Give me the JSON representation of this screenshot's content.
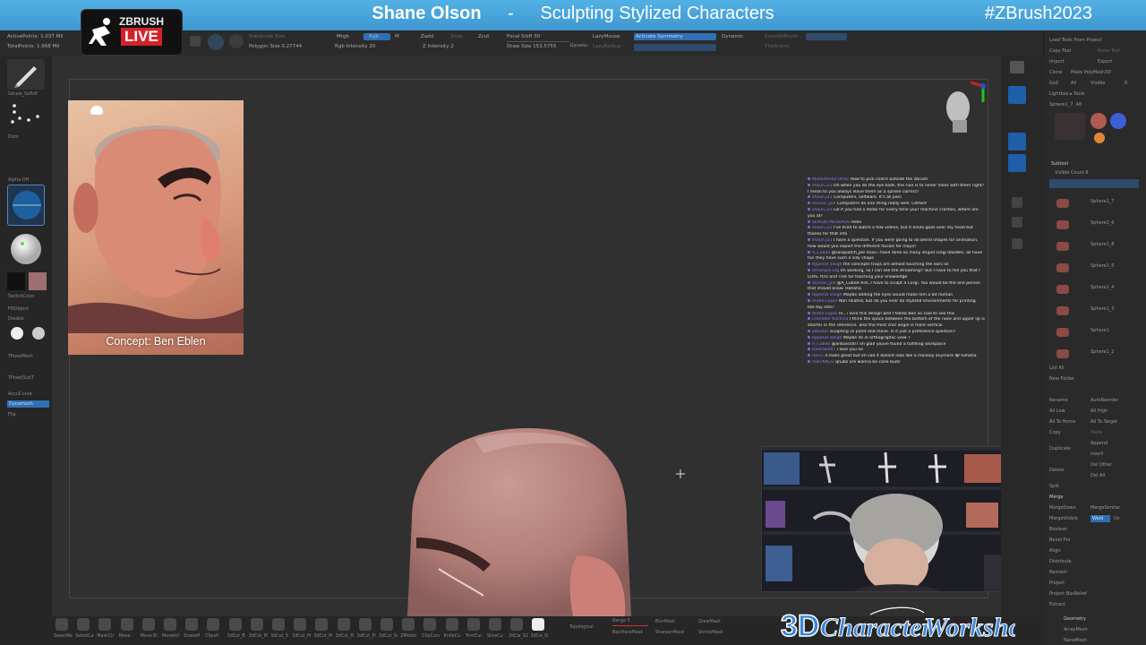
{
  "banner": {
    "presenter": "Shane Olson",
    "separator": "-",
    "course": "Sculpting Stylized Characters",
    "hashtag": "#ZBrush2023"
  },
  "logo": {
    "zbrush": "ZBRUSH",
    "live": "LIVE"
  },
  "toolbar": {
    "active_points": "ActivePoints: 1.037 Mil",
    "total_points": "TotalPoints: 1.968 Mil",
    "subdivide": "Subdivide Size",
    "polygon_size": "Polygon Size 0.27744",
    "mrgb": "Mrgb",
    "rgb": "Rgb",
    "m": "M",
    "zadd": "Zadd",
    "zsub": "Zsub",
    "zcut": "Zcut",
    "rgb_intensity": "Rgb Intensity 20",
    "z_intensity": "Z Intensity 2",
    "focal_shift": "Focal Shift 30",
    "draw_size": "Draw Size 153.5755",
    "dynamic_label": "Dynamic",
    "lazy_mouse": "LazyMouse",
    "lazy_radius": "LazyRadius",
    "activate_symmetry": "Activate Symmetry",
    "dynamic": "Dynamic",
    "smooth_brush": "SmoothBrush",
    "thickness": "Thickness"
  },
  "leftshelf": {
    "brush": "Sdraw_Softdf",
    "stroke": "Dots",
    "alpha": "Alpha Off",
    "switch_color": "SwitchColor",
    "fill_object": "FillObject",
    "double": "Double",
    "tpose_mesh": "TPoseMesh",
    "tpose_subt": "TPose|SubT",
    "accucurve": "AccuCurve",
    "backfacemask": "Dynamesh",
    "flip": "Flip"
  },
  "concept_caption": "Concept: Ben Eblen",
  "chat": [
    {
      "user": "Muhammad Umar",
      "text": "How to pick colors outside the zbrush"
    },
    {
      "user": "shaun.j31",
      "text": "Oh when you do the eye balls, the rule is to never mess with them right?"
    },
    {
      "user": "",
      "text": "I mean to you always leave them as a sphere correct?"
    },
    {
      "user": "shaun.j31",
      "text": "Computers, software. It's all pain"
    },
    {
      "user": "duncan_pie",
      "text": "Computers do one thing really well. CRASH!"
    },
    {
      "user": "shaun.j31",
      "text": "Lol if you had a dollar for every time your machine crashes, where are"
    },
    {
      "user": "",
      "text": "you at?"
    },
    {
      "user": "SERGIO MEDEROS",
      "text": "Hello"
    },
    {
      "user": "shaun.j31",
      "text": "I've tried to watch a few videos, but it kinda goes over my head but"
    },
    {
      "user": "",
      "text": "thanks for that info"
    },
    {
      "user": "shaun.j31",
      "text": "I have a question. If you were going to do blend shapes for animation,"
    },
    {
      "user": "",
      "text": "how would you export the different facials for maya?"
    },
    {
      "user": "A_Cubed",
      "text": "@sasquatch_pie lmao i have done so many stupid corgi doodles. all have"
    },
    {
      "user": "",
      "text": "fun they have such a silly shape"
    },
    {
      "user": "Rpperat sleigh",
      "text": "the concepts traps are almost touching the ears lol"
    },
    {
      "user": "lemonpie.org",
      "text": "Im working, so I can see the streaming!! but I have to tell you that I"
    },
    {
      "user": "",
      "text": "LOVE YOU and THX for teaching your knowledge"
    },
    {
      "user": "duncan_pie",
      "text": "@A_Cubed Ash, I have to sculpt a Corgi. You would be the one person"
    },
    {
      "user": "",
      "text": "that should know. Hahaha"
    },
    {
      "user": "Rpperat sleigh",
      "text": "Maybe adding the eyes would make him a bit human"
    },
    {
      "user": "Andre Lopes",
      "text": "Non related, but do you ever do stylized environments for printing"
    },
    {
      "user": "",
      "text": "like toy sets?"
    },
    {
      "user": "Andre Lopes",
      "text": "Hi.. i love this design and I follow Ben so cool to see this"
    },
    {
      "user": "Chendler Kachina",
      "text": "I think the space between the bottom of the nose and upper lip is"
    },
    {
      "user": "",
      "text": "shorter in the reference. also the front chin angle is more vertical"
    },
    {
      "user": "jdbutter",
      "text": "sculpting vs paint and move. Is it just a preference question?"
    },
    {
      "user": "Rpperat sleigh",
      "text": "Maybe its in orthographic view ?"
    },
    {
      "user": "A_Cubed",
      "text": "@antoxic007 im glad youve found a fulfilling workplace"
    },
    {
      "user": "Dantazio07",
      "text": "i love you lol"
    },
    {
      "user": "rkk1x",
      "text": "it looks great but im sad it doesnt look like a monkey anymore 😂 hahaha"
    },
    {
      "user": "mel1f0622",
      "text": "qnubs are wanna be cane buds"
    }
  ],
  "rightpanel": {
    "load_tools": "Load Tools From Project",
    "copy_tool": "Copy Tool",
    "paste_tool": "Paste Tool",
    "import": "Import",
    "export": "Export",
    "clone": "Clone",
    "make_polymesh": "Make PolyMesh3D",
    "goz": "GoZ",
    "all": "All",
    "visible": "Visible",
    "r": "R",
    "lightbox": "Lightbox ▸ Tools",
    "sphere_name": "Sphere1_7. 48",
    "subtool": "Subtool",
    "visible_count": "Visible Count 8",
    "items": [
      "Sphere1_7",
      "Sphere1_6",
      "Sphere1_8",
      "Sphere1_5",
      "Sphere1_4",
      "Sphere1_3",
      "Sphere1",
      "Sphere1_2"
    ],
    "list_all": "List All",
    "new_folder": "New Folder",
    "rename": "Rename",
    "auto_reorder": "AutoReorder",
    "all_low": "All Low",
    "all_high": "All High",
    "all_to_home": "All To Home",
    "all_to_target": "All To Target",
    "copy": "Copy",
    "paste": "Paste",
    "duplicate": "Duplicate",
    "append": "Append",
    "insert": "Insert",
    "delete": "Delete",
    "del_other": "Del Other",
    "del_all": "Del All",
    "split": "Split",
    "merge": "Merge",
    "merge_down": "MergeDown",
    "merge_similar": "MergeSimilar",
    "merge_visible": "MergeVisible",
    "weld": "Weld",
    "uv": "Uv",
    "boolean": "Boolean",
    "bevel_pro": "Bevel Pro",
    "align": "Align",
    "distribute": "Distribute",
    "remesh": "Remesh",
    "project": "Project",
    "project_bas_relief": "Project BasRelief",
    "extract": "Extract",
    "geometry": "Geometry",
    "array_mesh": "ArrayMesh",
    "nano_mesh": "NanoMesh"
  },
  "bottombar": {
    "tools": [
      "SelectRe",
      "SelectLa",
      "MaskCir",
      "Move",
      "Move El",
      "MoveInf",
      "SnakeH",
      "ClipsH",
      "3dCut_B",
      "3dCut_M",
      "3dCut_S",
      "3dCut_M",
      "3dCut_Pi",
      "3dCut_Pi",
      "3dCut_Pi",
      "3dCut_Si"
    ],
    "tools2": [
      "ZModel",
      "ClipCurv",
      "KnifeCu",
      "TrimCur",
      "SliceCu",
      "3dCw_S1",
      "3dCw_Sl"
    ],
    "topological": "Topological",
    "range": "Range 5",
    "blur_mask": "BlurMask",
    "grow_mask": "GrowMask",
    "backface_mask": "BackfaceMask",
    "sharpen_mask": "SharpenMask",
    "shrink_mask": "ShrinkMask"
  },
  "workshop_logo": "3D Character Workshop",
  "colors": {
    "banner": "#4aa6dc",
    "canvas": "#303030",
    "accent_blue": "#2f6fb5",
    "live_red": "#d2232a"
  }
}
